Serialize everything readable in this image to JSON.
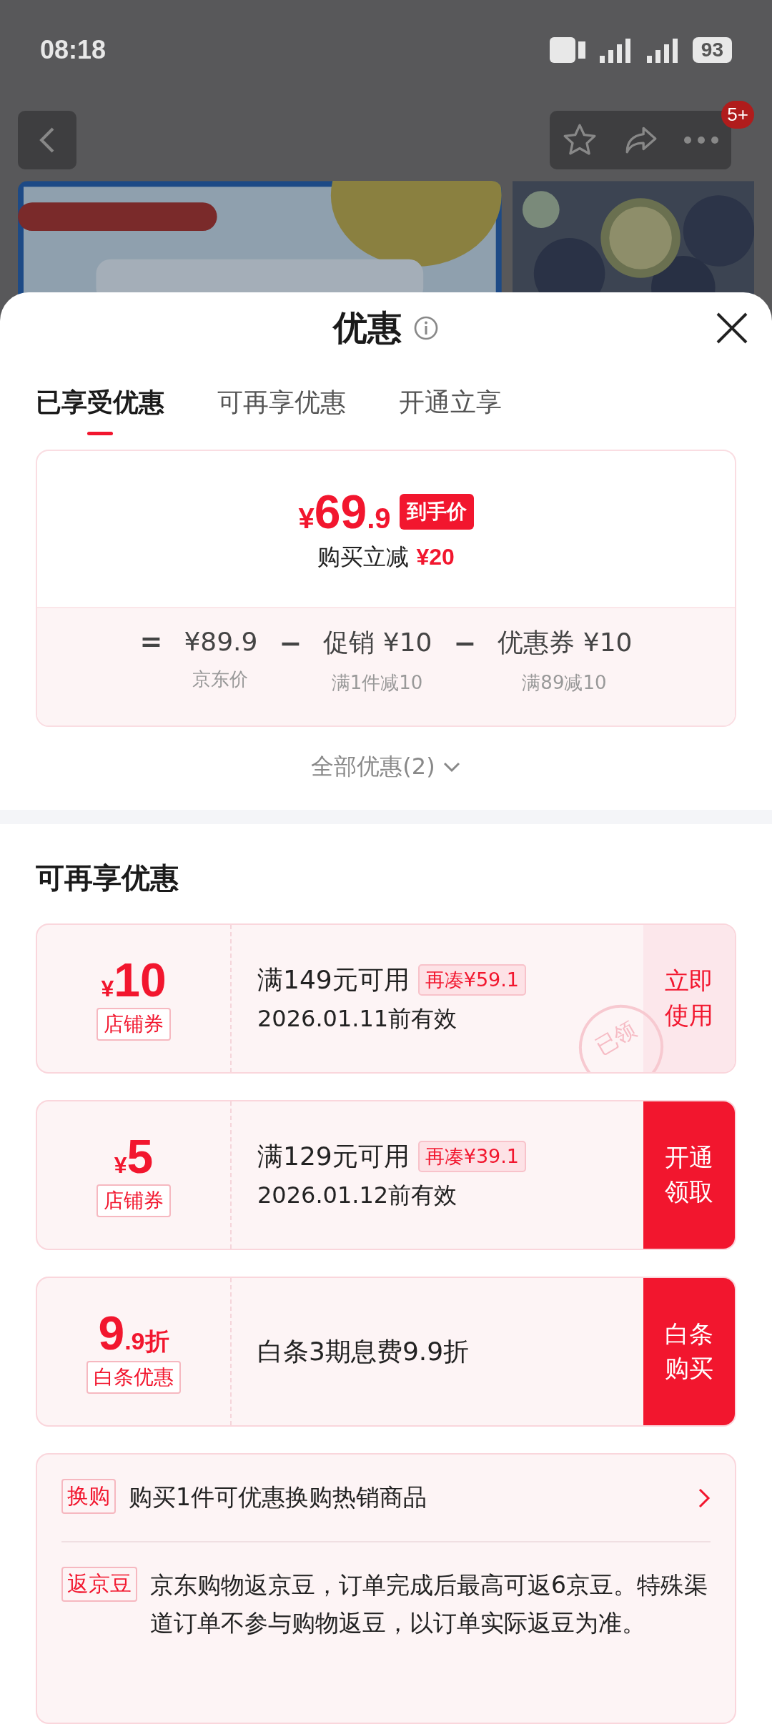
{
  "status_bar": {
    "time": "08:18",
    "battery": "93"
  },
  "top_bar": {
    "badge": "5+"
  },
  "sheet": {
    "title": "优惠",
    "tabs": [
      {
        "label": "已享受优惠",
        "selected": true
      },
      {
        "label": "可再享优惠",
        "selected": false
      },
      {
        "label": "开通立享",
        "selected": false
      }
    ],
    "price_card": {
      "price_symbol": "¥",
      "price_int": "69",
      "price_dec": ".9",
      "price_badge": "到手价",
      "saving_label": "购买立减",
      "saving_value": "¥20",
      "breakdown": [
        {
          "op": "=",
          "value": "¥89.9",
          "note": "京东价"
        },
        {
          "op": "−",
          "value": "促销 ¥10",
          "note": "满1件减10"
        },
        {
          "op": "−",
          "value": "优惠券 ¥10",
          "note": "满89减10"
        }
      ]
    },
    "all_offers": "全部优惠(2)",
    "section_title": "可再享优惠",
    "coupons": [
      {
        "kind": "light",
        "prefix": "¥",
        "main": "10",
        "type_label": "店铺券",
        "condition": "满149元可用",
        "gap_tag": "再凑¥59.1",
        "validity": "2026.01.11前有效",
        "stamp": "已领",
        "action": [
          "立即",
          "使用"
        ]
      },
      {
        "kind": "solid",
        "prefix": "¥",
        "main": "5",
        "type_label": "店铺券",
        "condition": "满129元可用",
        "gap_tag": "再凑¥39.1",
        "validity": "2026.01.12前有效",
        "action": [
          "开通",
          "领取"
        ]
      },
      {
        "kind": "solid",
        "main": "9",
        "suffix": ".9折",
        "type_label": "白条优惠",
        "condition": "白条3期息费9.9折",
        "action": [
          "白条",
          "购买"
        ]
      }
    ],
    "benefits": [
      {
        "tag": "换购",
        "text": "购买1件可优惠换购热销商品",
        "has_link": true
      },
      {
        "tag": "返京豆",
        "text": "京东购物返京豆，订单完成后最高可返6京豆。特殊渠道订单不参与购物返豆，以订单实际返豆为准。",
        "has_link": false
      }
    ]
  }
}
